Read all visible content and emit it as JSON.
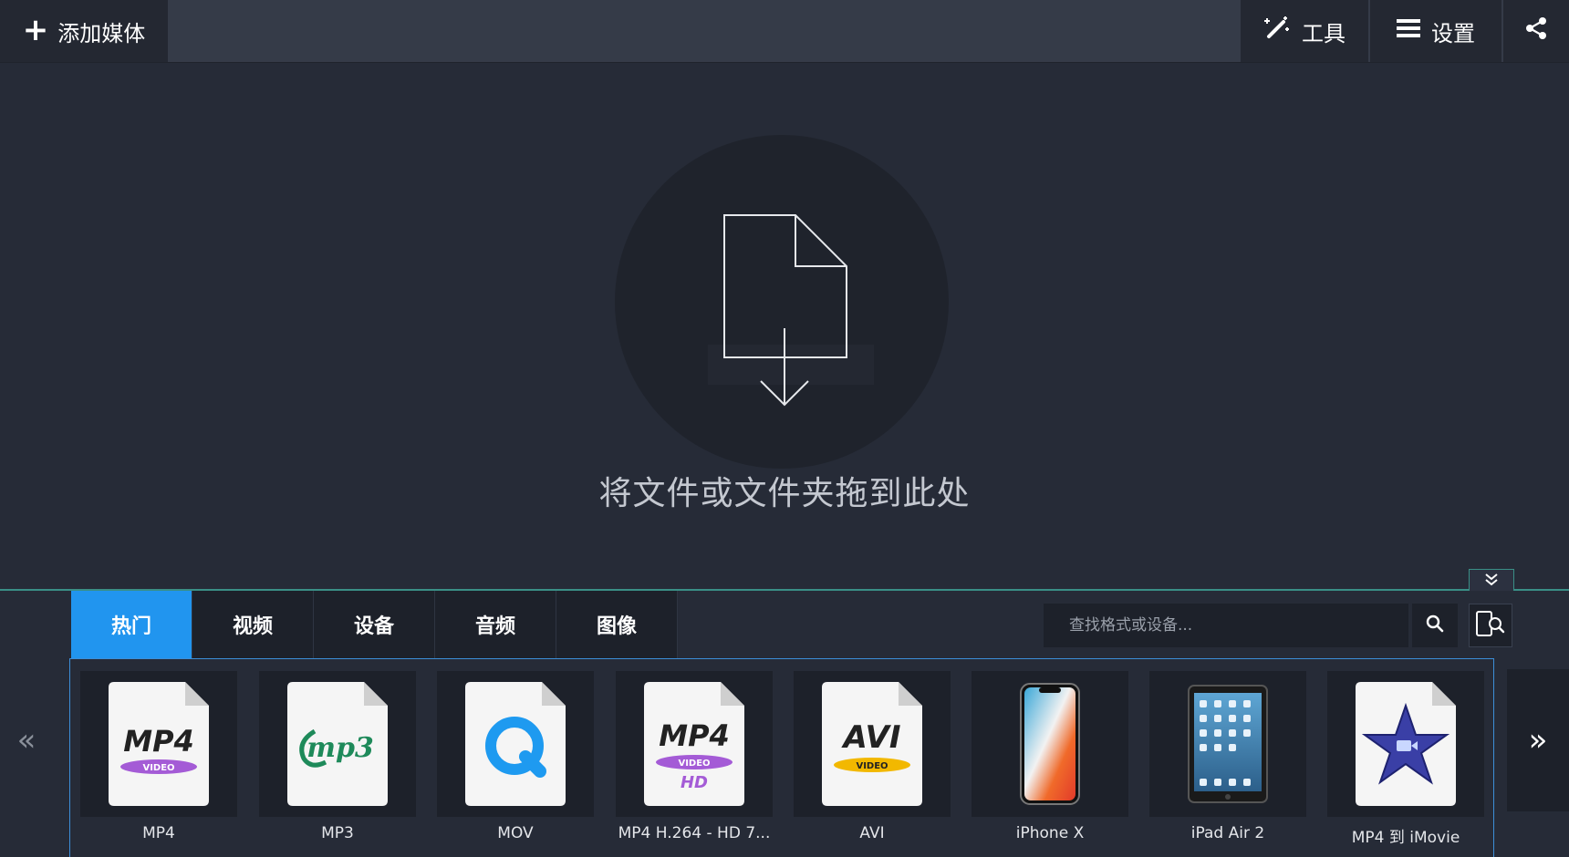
{
  "header": {
    "add_media_label": "添加媒体",
    "tools_label": "工具",
    "settings_label": "设置"
  },
  "dropzone": {
    "text": "将文件或文件夹拖到此处"
  },
  "tabs": [
    {
      "label": "热门",
      "active": true
    },
    {
      "label": "视频",
      "active": false
    },
    {
      "label": "设备",
      "active": false
    },
    {
      "label": "音频",
      "active": false
    },
    {
      "label": "图像",
      "active": false
    }
  ],
  "search": {
    "placeholder": "查找格式或设备..."
  },
  "formats": [
    {
      "label": "MP4",
      "icon": "mp4-file-icon",
      "badge": "MP4",
      "sub": "VIDEO"
    },
    {
      "label": "MP3",
      "icon": "mp3-file-icon",
      "badge": "mp3"
    },
    {
      "label": "MOV",
      "icon": "quicktime-file-icon"
    },
    {
      "label": "MP4 H.264 - HD 7...",
      "icon": "mp4-hd-file-icon",
      "badge": "MP4",
      "sub": "VIDEO",
      "extra": "HD"
    },
    {
      "label": "AVI",
      "icon": "avi-file-icon",
      "badge": "AVI",
      "sub": "VIDEO"
    },
    {
      "label": "iPhone X",
      "icon": "iphone-x-icon"
    },
    {
      "label": "iPad Air 2",
      "icon": "ipad-air-icon"
    },
    {
      "label": "MP4 到 iMovie",
      "icon": "imovie-star-icon"
    }
  ],
  "colors": {
    "accent_tab": "#2195ef",
    "panel_border": "#3c8ed8",
    "divider": "#3a8f86",
    "mp4_badge": "#a45bd6",
    "mp3_green": "#1e8a5a",
    "quicktime_blue": "#1e9af0",
    "avi_badge": "#f2b800",
    "imovie_purple": "#3a3fa6"
  }
}
